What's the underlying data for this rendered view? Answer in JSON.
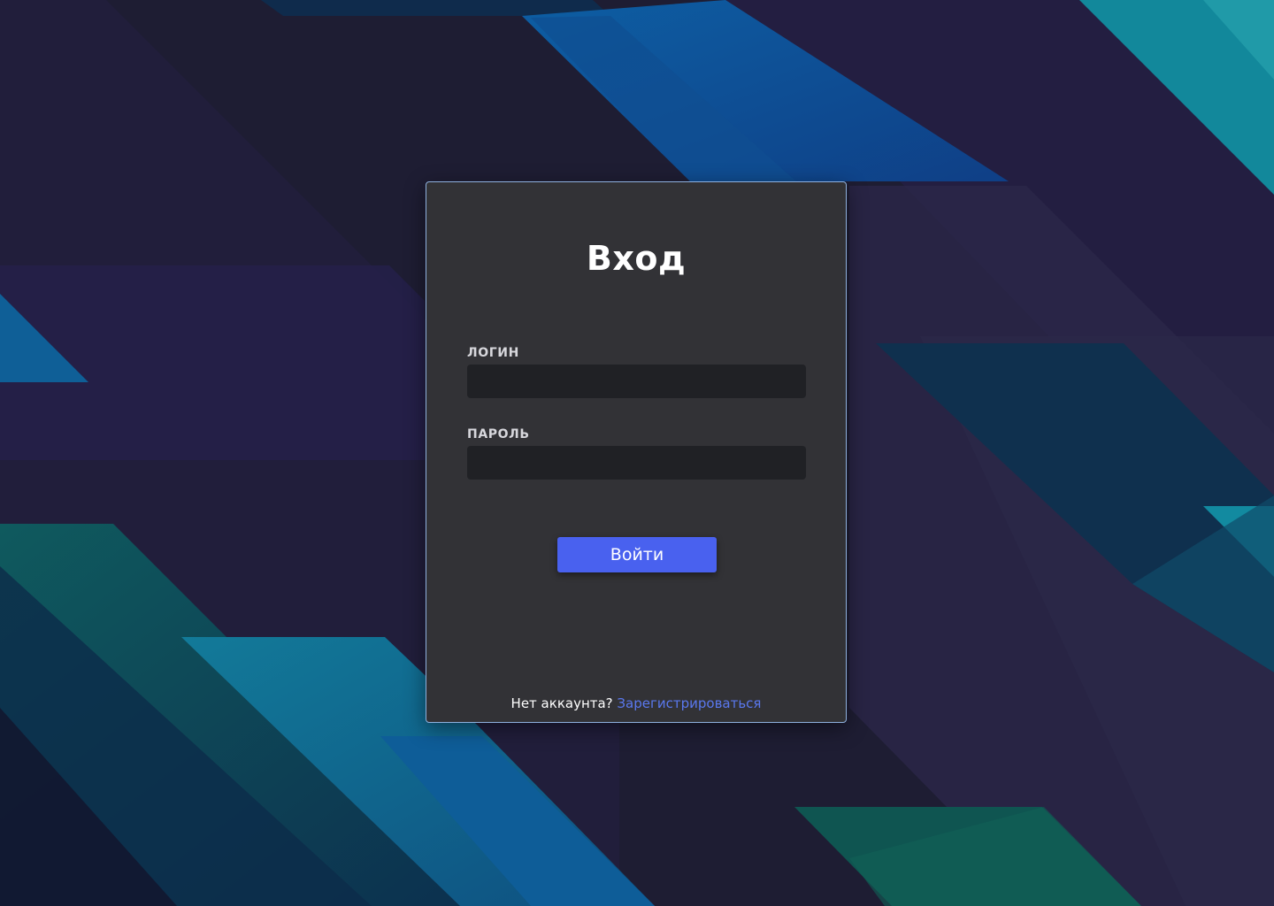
{
  "page": {
    "background_colors": [
      "#1f1d35",
      "#0e5a96",
      "#1183a1",
      "#0f5b5a"
    ]
  },
  "login_form": {
    "title": "Вход",
    "login": {
      "label": "ЛОГИН",
      "value": "",
      "placeholder": ""
    },
    "password": {
      "label": "ПАРОЛЬ",
      "value": "",
      "placeholder": ""
    },
    "submit_label": "Войти",
    "footer_text": "Нет аккаунта?",
    "register_link": "Зарегистрироваться",
    "colors": {
      "card_bg": "#323236",
      "card_border": "#8fb1de",
      "input_bg": "#202125",
      "button_bg": "#4961ef",
      "link": "#5a78ee"
    }
  }
}
